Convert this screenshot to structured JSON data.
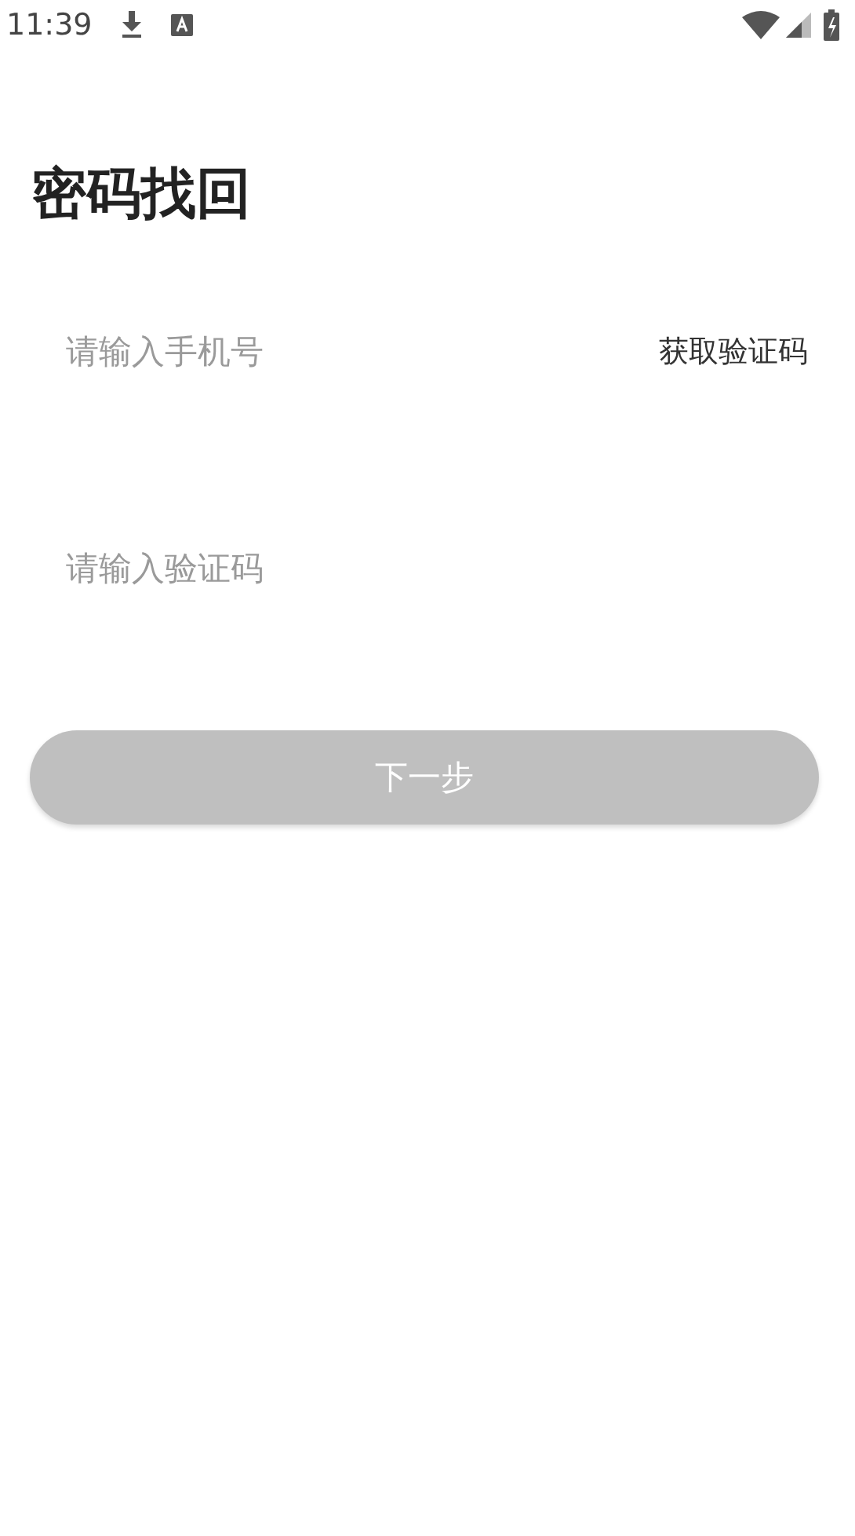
{
  "status_bar": {
    "time": "11:39"
  },
  "title": "密码找回",
  "phone_field": {
    "placeholder": "请输入手机号"
  },
  "get_code_button": {
    "label": "获取验证码"
  },
  "code_field": {
    "placeholder": "请输入验证码"
  },
  "next_button": {
    "label": "下一步",
    "disabled": true
  }
}
